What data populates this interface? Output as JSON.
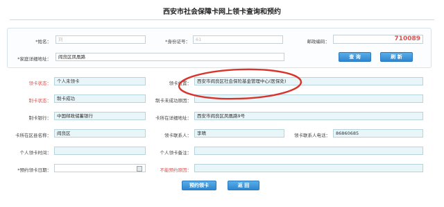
{
  "page": {
    "title": "西安市社会保障卡网上领卡查询和预约"
  },
  "top": {
    "name_label": "*姓名：",
    "name_value": "刘",
    "id_label": "*身份证号：",
    "id_value": "61",
    "zip_label": "邮政编码：",
    "zip_value": "710089",
    "address_label": "*家庭详细地址：",
    "address_value": "阎良区凤凰路",
    "query_button": "查 询",
    "refresh_button": "刷 新"
  },
  "form": {
    "card_status_label": "领卡状态：",
    "card_status_value": "个人未领卡",
    "card_location_label": "领卡位置：",
    "card_location_value": "西安市阎良区社会保险基金管理中心(医保处)",
    "make_status_label": "制卡状态：",
    "make_status_value": "制卡成功",
    "fail_reason_label": "制卡未成功原因：",
    "fail_reason_value": "",
    "bank_label": "制卡银行：",
    "bank_value": "中国邮政储蓄银行",
    "card_address_label": "卡所在详细地址：",
    "card_address_value": "西安市阎良区凤凰路9号",
    "district_label": "卡所在区县名称：",
    "district_value": "阎良区",
    "contact_label": "领卡联系人：",
    "contact_value": "李晴",
    "phone_label": "领卡联系人电话：",
    "phone_value": "86860685",
    "personal_time_label": "个人领卡时间：",
    "personal_time_value": "",
    "personal_note_label": "个人领卡备注：",
    "personal_note_value": "",
    "booking_date_label": "*预约领卡日期：",
    "booking_date_value": "",
    "no_booking_label": "不能预约原因：",
    "no_booking_value": "",
    "book_button": "预约领卡",
    "back_button": "返 回"
  },
  "colors": {
    "accent": "#2f86cf",
    "field_bg": "#e8f5f9",
    "warning": "#d9534f",
    "annotation": "#d9342b"
  }
}
